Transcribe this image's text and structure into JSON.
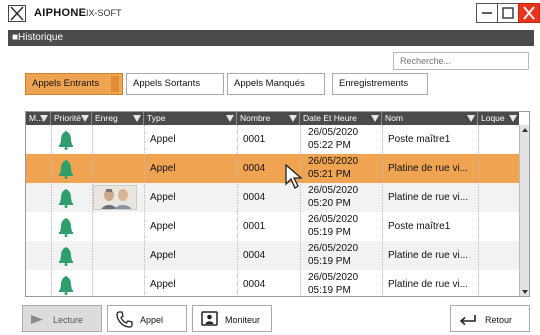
{
  "titlebar": {
    "brand": "AIPHONE",
    "product": "IX-SOFT",
    "logo_icon": "ix-logo-icon",
    "buttons": [
      "minimize-icon",
      "maximize-icon",
      "close-icon"
    ],
    "close_color": "#e8361c"
  },
  "section": {
    "title": "■Historique"
  },
  "search": {
    "placeholder": "Recherche..."
  },
  "tabs": [
    {
      "label": "Appels Entrants",
      "active": true
    },
    {
      "label": "Appels Sortants",
      "active": false
    },
    {
      "label": "Appels Manqués",
      "active": false
    },
    {
      "label": "Enregistrements",
      "active": false
    }
  ],
  "table": {
    "columns": [
      "M...",
      "Priorité",
      "Enreg",
      "Type",
      "Nombre",
      "Date Et Heure",
      "Nom",
      "Loque"
    ],
    "rows": [
      {
        "type": "Appel",
        "number": "0001",
        "date": "26/05/2020",
        "time": "05:22 PM",
        "name": "Poste maître1",
        "recording": false,
        "selected": false
      },
      {
        "type": "Appel",
        "number": "0004",
        "date": "26/05/2020",
        "time": "05:21 PM",
        "name": "Platine de rue vi...",
        "recording": false,
        "selected": true
      },
      {
        "type": "Appel",
        "number": "0004",
        "date": "26/05/2020",
        "time": "05:20 PM",
        "name": "Platine de rue vi...",
        "recording": true,
        "selected": false
      },
      {
        "type": "Appel",
        "number": "0001",
        "date": "26/05/2020",
        "time": "05:19 PM",
        "name": "Poste maître1",
        "recording": false,
        "selected": false
      },
      {
        "type": "Appel",
        "number": "0004",
        "date": "26/05/2020",
        "time": "05:19 PM",
        "name": "Platine de rue vi...",
        "recording": false,
        "selected": false
      },
      {
        "type": "Appel",
        "number": "0004",
        "date": "26/05/2020",
        "time": "05:19 PM",
        "name": "Platine de rue vi...",
        "recording": false,
        "selected": false
      }
    ],
    "priority_icon": "bell-icon",
    "priority_color": "#2e9f6a",
    "selected_color": "#f0a451"
  },
  "buttons": {
    "lecture": "Lecture",
    "appel": "Appel",
    "moniteur": "Moniteur",
    "retour": "Retour"
  }
}
